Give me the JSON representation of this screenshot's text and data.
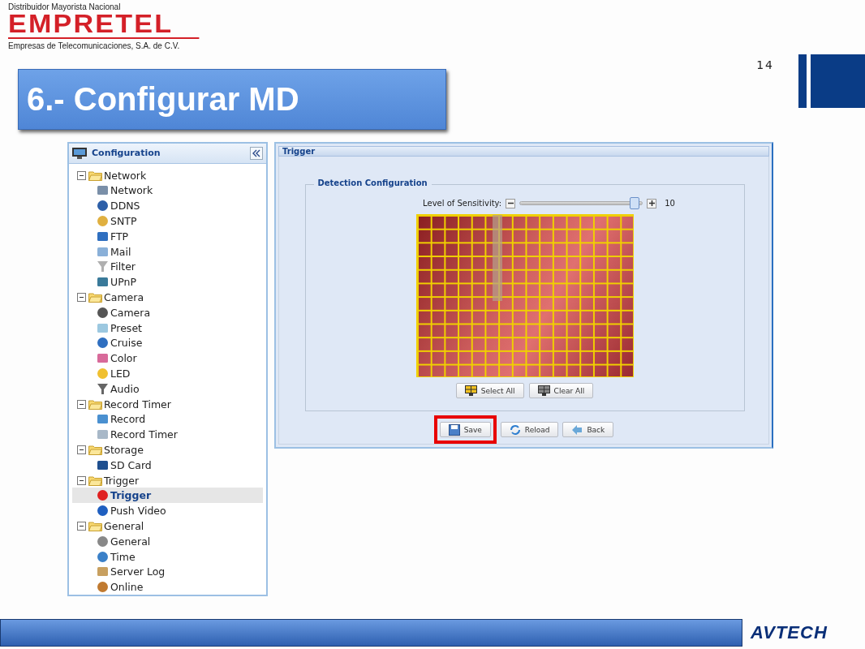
{
  "header": {
    "tagline": "Distribuidor Mayorista Nacional",
    "logo": "EMPRETEL",
    "company": "Empresas de Telecomunicaciones, S.A. de C.V."
  },
  "page_number": "14",
  "title": "6.- Configurar MD",
  "sidebar": {
    "title": "Configuration",
    "tree": [
      {
        "label": "Network",
        "expanded": true,
        "children": [
          {
            "label": "Network",
            "selected": false
          },
          {
            "label": "DDNS",
            "selected": false
          },
          {
            "label": "SNTP",
            "selected": false
          },
          {
            "label": "FTP",
            "selected": false
          },
          {
            "label": "Mail",
            "selected": false
          },
          {
            "label": "Filter",
            "selected": false
          },
          {
            "label": "UPnP",
            "selected": false
          }
        ]
      },
      {
        "label": "Camera",
        "expanded": true,
        "children": [
          {
            "label": "Camera",
            "selected": false
          },
          {
            "label": "Preset",
            "selected": false
          },
          {
            "label": "Cruise",
            "selected": false
          },
          {
            "label": "Color",
            "selected": false
          },
          {
            "label": "LED",
            "selected": false
          },
          {
            "label": "Audio",
            "selected": false
          }
        ]
      },
      {
        "label": "Record Timer",
        "expanded": true,
        "children": [
          {
            "label": "Record",
            "selected": false
          },
          {
            "label": "Record Timer",
            "selected": false
          }
        ]
      },
      {
        "label": "Storage",
        "expanded": true,
        "children": [
          {
            "label": "SD Card",
            "selected": false
          }
        ]
      },
      {
        "label": "Trigger",
        "expanded": true,
        "children": [
          {
            "label": "Trigger",
            "selected": true
          },
          {
            "label": "Push Video",
            "selected": false
          }
        ]
      },
      {
        "label": "General",
        "expanded": true,
        "children": [
          {
            "label": "General",
            "selected": false
          },
          {
            "label": "Time",
            "selected": false
          },
          {
            "label": "Server Log",
            "selected": false
          },
          {
            "label": "Online",
            "selected": false
          }
        ]
      }
    ]
  },
  "panel": {
    "title": "Trigger",
    "section": "Detection Configuration",
    "sensitivity": {
      "label": "Level of Sensitivity:",
      "level": 0.97,
      "reading": "10"
    },
    "grid_buttons": [
      "Select All",
      "Clear All"
    ],
    "buttons": [
      {
        "label": "Save",
        "highlighted": true
      },
      {
        "label": "Reload",
        "highlighted": false
      },
      {
        "label": "Back",
        "highlighted": false
      }
    ]
  },
  "footer": {
    "logo": "AVTECH"
  }
}
